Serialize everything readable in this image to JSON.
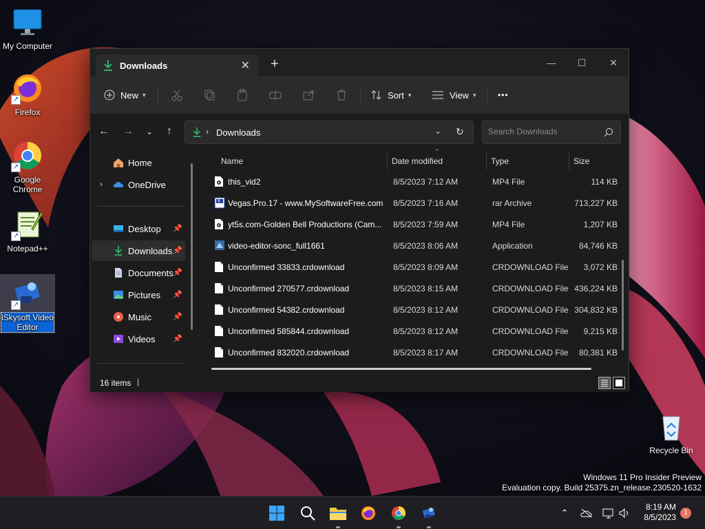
{
  "desktop": {
    "icons": [
      {
        "label": "My Computer",
        "icon": "monitor-icon"
      },
      {
        "label": "Firefox",
        "icon": "firefox-icon"
      },
      {
        "label": "Google Chrome",
        "icon": "chrome-icon"
      },
      {
        "label": "Notepad++",
        "icon": "notepad-plus-plus-icon"
      },
      {
        "label": "iSkysoft Video Editor",
        "icon": "iskysoft-video-editor-icon",
        "selected": true
      }
    ],
    "recycle_bin": "Recycle Bin",
    "watermark": {
      "line1": "Windows 11 Pro Insider Preview",
      "line2": "Evaluation copy. Build 25375.zn_release.230520-1632"
    }
  },
  "explorer": {
    "tab_title": "Downloads",
    "commands": {
      "new": "New",
      "sort": "Sort",
      "view": "View",
      "more": "•••"
    },
    "address": {
      "crumb": "Downloads"
    },
    "search": {
      "placeholder": "Search Downloads"
    },
    "nav": {
      "items": [
        {
          "label": "Home",
          "icon": "home-icon"
        },
        {
          "label": "OneDrive",
          "icon": "cloud-icon"
        },
        {
          "label": "Desktop",
          "icon": "desktop-folder-icon",
          "pinned": true
        },
        {
          "label": "Downloads",
          "icon": "download-icon",
          "pinned": true,
          "active": true
        },
        {
          "label": "Documents",
          "icon": "documents-icon",
          "pinned": true
        },
        {
          "label": "Pictures",
          "icon": "pictures-icon",
          "pinned": true
        },
        {
          "label": "Music",
          "icon": "music-icon",
          "pinned": true
        },
        {
          "label": "Videos",
          "icon": "videos-icon",
          "pinned": true
        }
      ]
    },
    "columns": {
      "name": "Name",
      "date": "Date modified",
      "type": "Type",
      "size": "Size"
    },
    "files": [
      {
        "name": "this_vid2",
        "date": "8/5/2023 7:12 AM",
        "type": "MP4 File",
        "size": "114 KB",
        "icon": "video-file-icon"
      },
      {
        "name": "Vegas.Pro.17 - www.MySoftwareFree.com",
        "date": "8/5/2023 7:16 AM",
        "type": "rar Archive",
        "size": "713,227 KB",
        "icon": "archive-file-icon"
      },
      {
        "name": "yt5s.com-Golden Bell Productions (Cam...",
        "date": "8/5/2023 7:59 AM",
        "type": "MP4 File",
        "size": "1,207 KB",
        "icon": "video-file-icon"
      },
      {
        "name": "video-editor-sonc_full1661",
        "date": "8/5/2023 8:06 AM",
        "type": "Application",
        "size": "84,746 KB",
        "icon": "application-icon"
      },
      {
        "name": "Unconfirmed 33833.crdownload",
        "date": "8/5/2023 8:09 AM",
        "type": "CRDOWNLOAD File",
        "size": "3,072 KB",
        "icon": "blank-file-icon"
      },
      {
        "name": "Unconfirmed 270577.crdownload",
        "date": "8/5/2023 8:15 AM",
        "type": "CRDOWNLOAD File",
        "size": "436,224 KB",
        "icon": "blank-file-icon"
      },
      {
        "name": "Unconfirmed 54382.crdownload",
        "date": "8/5/2023 8:12 AM",
        "type": "CRDOWNLOAD File",
        "size": "304,832 KB",
        "icon": "blank-file-icon"
      },
      {
        "name": "Unconfirmed 585844.crdownload",
        "date": "8/5/2023 8:12 AM",
        "type": "CRDOWNLOAD File",
        "size": "9,215 KB",
        "icon": "blank-file-icon"
      },
      {
        "name": "Unconfirmed 832020.crdownload",
        "date": "8/5/2023 8:17 AM",
        "type": "CRDOWNLOAD File",
        "size": "80,381 KB",
        "icon": "blank-file-icon"
      }
    ],
    "status": {
      "count": "16 items",
      "separator": "|"
    }
  },
  "taskbar": {
    "apps": [
      "windows-start-icon",
      "search-icon",
      "file-explorer-icon",
      "firefox-icon",
      "chrome-icon",
      "iskysoft-video-editor-icon"
    ],
    "time": "8:19 AM",
    "date": "8/5/2023",
    "notification_count": "1"
  },
  "colors": {
    "accent": "#0a64d8",
    "download_green": "#2fb36b"
  }
}
